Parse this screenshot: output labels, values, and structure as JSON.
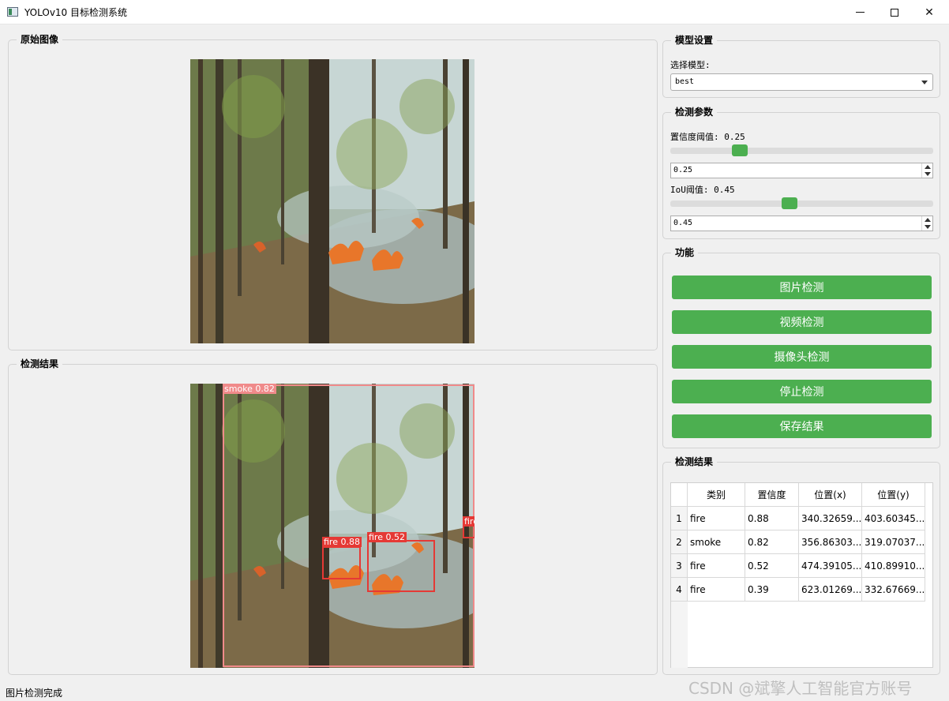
{
  "window": {
    "title": "YOLOv10 目标检测系统"
  },
  "panels": {
    "original_title": "原始图像",
    "result_title": "检测结果"
  },
  "model_settings": {
    "title": "模型设置",
    "select_label": "选择模型:",
    "selected_model": "best"
  },
  "detection_params": {
    "title": "检测参数",
    "conf_label": "置信度阈值: 0.25",
    "conf_value": "0.25",
    "conf_level": 0.25,
    "iou_label": "IoU阈值: 0.45",
    "iou_value": "0.45",
    "iou_level": 0.45
  },
  "functions": {
    "title": "功能",
    "buttons": [
      "图片检测",
      "视频检测",
      "摄像头检测",
      "停止检测",
      "保存结果"
    ]
  },
  "results": {
    "title": "检测结果",
    "headers": [
      "类别",
      "置信度",
      "位置(x)",
      "位置(y)"
    ],
    "rows": [
      {
        "index": "1",
        "cls": "fire",
        "conf": "0.88",
        "x": "340.32659...",
        "y": "403.60345..."
      },
      {
        "index": "2",
        "cls": "smoke",
        "conf": "0.82",
        "x": "356.86303...",
        "y": "319.07037..."
      },
      {
        "index": "3",
        "cls": "fire",
        "conf": "0.52",
        "x": "474.39105...",
        "y": "410.89910..."
      },
      {
        "index": "4",
        "cls": "fire",
        "conf": "0.39",
        "x": "623.01269...",
        "y": "332.67669..."
      }
    ]
  },
  "detections": [
    {
      "label": "smoke 0.82",
      "color": "#f08a8a"
    },
    {
      "label": "fire 0.88",
      "color": "#e53935"
    },
    {
      "label": "fire 0.52",
      "color": "#e53935"
    },
    {
      "label": "fire",
      "color": "#e53935"
    }
  ],
  "status": "图片检测完成",
  "watermark": "CSDN @斌擎人工智能官方账号",
  "accent_color": "#4caf50"
}
